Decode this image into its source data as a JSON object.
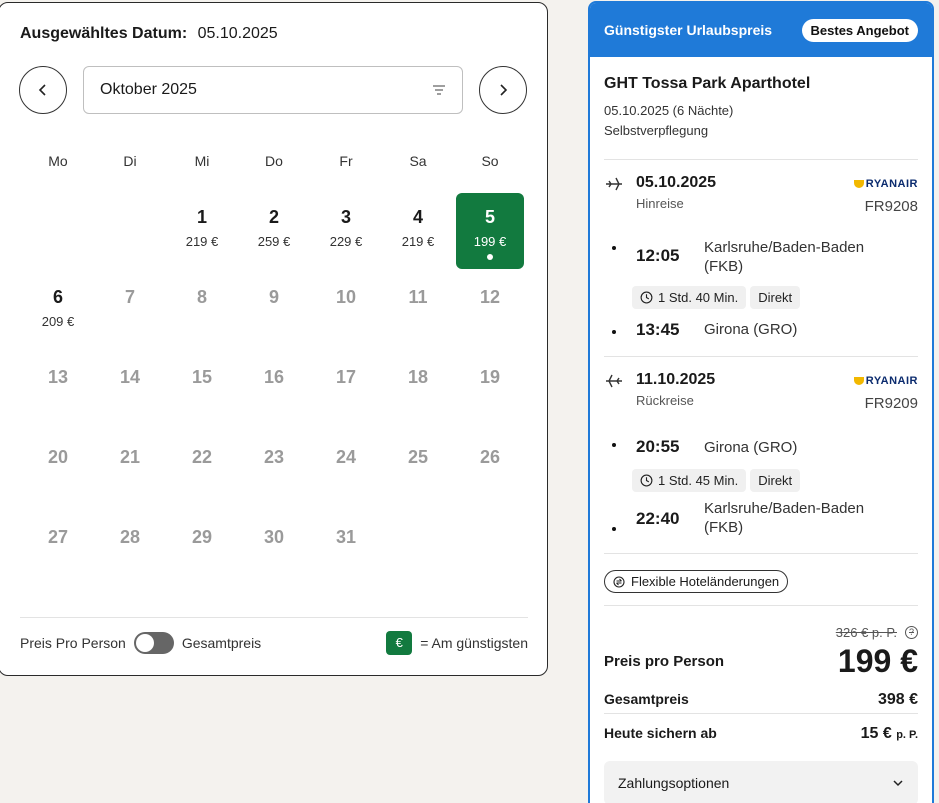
{
  "calendar": {
    "selected_label": "Ausgewähltes Datum:",
    "selected_value": "05.10.2025",
    "month": "Oktober 2025",
    "weekdays": [
      "Mo",
      "Di",
      "Mi",
      "Do",
      "Fr",
      "Sa",
      "So"
    ],
    "days": [
      {
        "num": "",
        "price": "",
        "state": "empty"
      },
      {
        "num": "",
        "price": "",
        "state": "empty"
      },
      {
        "num": "1",
        "price": "219 €",
        "state": "available"
      },
      {
        "num": "2",
        "price": "259 €",
        "state": "available"
      },
      {
        "num": "3",
        "price": "229 €",
        "state": "available"
      },
      {
        "num": "4",
        "price": "219 €",
        "state": "available"
      },
      {
        "num": "5",
        "price": "199 €",
        "state": "selected"
      },
      {
        "num": "6",
        "price": "209 €",
        "state": "available"
      },
      {
        "num": "7",
        "price": "",
        "state": "disabled"
      },
      {
        "num": "8",
        "price": "",
        "state": "disabled"
      },
      {
        "num": "9",
        "price": "",
        "state": "disabled"
      },
      {
        "num": "10",
        "price": "",
        "state": "disabled"
      },
      {
        "num": "11",
        "price": "",
        "state": "disabled"
      },
      {
        "num": "12",
        "price": "",
        "state": "disabled"
      },
      {
        "num": "13",
        "price": "",
        "state": "disabled"
      },
      {
        "num": "14",
        "price": "",
        "state": "disabled"
      },
      {
        "num": "15",
        "price": "",
        "state": "disabled"
      },
      {
        "num": "16",
        "price": "",
        "state": "disabled"
      },
      {
        "num": "17",
        "price": "",
        "state": "disabled"
      },
      {
        "num": "18",
        "price": "",
        "state": "disabled"
      },
      {
        "num": "19",
        "price": "",
        "state": "disabled"
      },
      {
        "num": "20",
        "price": "",
        "state": "disabled"
      },
      {
        "num": "21",
        "price": "",
        "state": "disabled"
      },
      {
        "num": "22",
        "price": "",
        "state": "disabled"
      },
      {
        "num": "23",
        "price": "",
        "state": "disabled"
      },
      {
        "num": "24",
        "price": "",
        "state": "disabled"
      },
      {
        "num": "25",
        "price": "",
        "state": "disabled"
      },
      {
        "num": "26",
        "price": "",
        "state": "disabled"
      },
      {
        "num": "27",
        "price": "",
        "state": "disabled"
      },
      {
        "num": "28",
        "price": "",
        "state": "disabled"
      },
      {
        "num": "29",
        "price": "",
        "state": "disabled"
      },
      {
        "num": "30",
        "price": "",
        "state": "disabled"
      },
      {
        "num": "31",
        "price": "",
        "state": "disabled"
      }
    ],
    "footer": {
      "per_person": "Preis Pro Person",
      "total": "Gesamtpreis",
      "legend_symbol": "€",
      "legend_text": "= Am günstigsten"
    }
  },
  "offer": {
    "header": "Günstigster Urlaubspreis",
    "badge": "Bestes Angebot",
    "hotel_name": "GHT Tossa Park Aparthotel",
    "dates": "05.10.2025 (6 Nächte)",
    "board": "Selbstverpflegung",
    "outbound": {
      "date": "05.10.2025",
      "direction": "Hinreise",
      "airline": "RYANAIR",
      "flight_no": "FR9208",
      "dep_time": "12:05",
      "dep_place": "Karlsruhe/Baden-Baden (FKB)",
      "duration": "1 Std. 40 Min.",
      "type": "Direkt",
      "arr_time": "13:45",
      "arr_place": "Girona (GRO)"
    },
    "return": {
      "date": "11.10.2025",
      "direction": "Rückreise",
      "airline": "RYANAIR",
      "flight_no": "FR9209",
      "dep_time": "20:55",
      "dep_place": "Girona (GRO)",
      "duration": "1 Std. 45 Min.",
      "type": "Direkt",
      "arr_time": "22:40",
      "arr_place": "Karlsruhe/Baden-Baden (FKB)"
    },
    "flex_label": "Flexible Hoteländerungen",
    "old_price": "326 € p. P.",
    "per_person_label": "Preis pro Person",
    "per_person_price": "199 €",
    "total_label": "Gesamtpreis",
    "total_price": "398 €",
    "deposit_label": "Heute sichern ab",
    "deposit_price": "15 €",
    "deposit_unit": "p. P.",
    "payment_label": "Zahlungsoptionen"
  },
  "colors": {
    "accent_green": "#127a3f",
    "accent_blue": "#1f7ad8"
  }
}
